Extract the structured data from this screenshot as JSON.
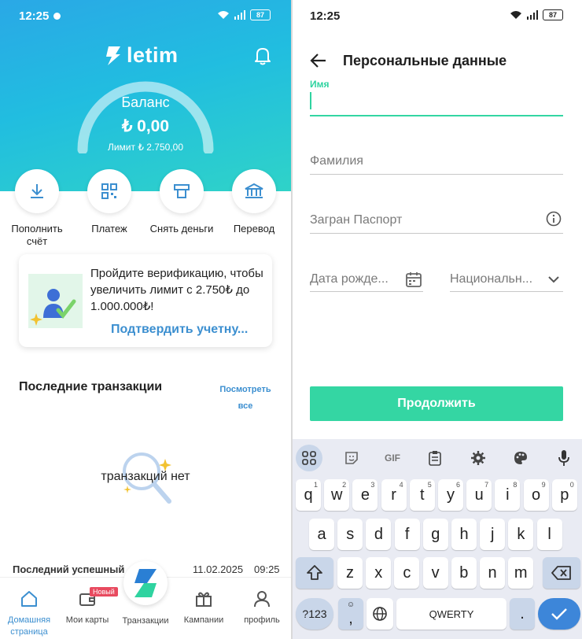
{
  "left": {
    "status": {
      "time": "12:25",
      "battery": "87"
    },
    "logo": "letim",
    "balance": {
      "title": "Баланс",
      "amount": "₺ 0,00",
      "limit": "Лимит  ₺ 2.750,00"
    },
    "actions": [
      {
        "label": "Пополнить счёт",
        "icon": "download-icon"
      },
      {
        "label": "Платеж",
        "icon": "qr-code-icon"
      },
      {
        "label": "Снять деньги",
        "icon": "atm-icon"
      },
      {
        "label": "Перевод",
        "icon": "bank-icon"
      }
    ],
    "verify_card": {
      "message": "Пройдите верификацию, чтобы увеличить лимит с 2.750₺ до 1.000.000₺!",
      "link": "Подтвердить учетну..."
    },
    "transactions": {
      "title": "Последние транзакции",
      "see_all": "Посмотреть все",
      "empty": "транзакций нет"
    },
    "last_success": {
      "label": "Последний успешный",
      "date": "11.02.2025",
      "time": "09:25"
    },
    "nav": {
      "home": "Домашняя страница",
      "cards": "Мои карты",
      "cards_badge": "Новый",
      "transactions": "Транзакции",
      "campaigns": "Кампании",
      "profile": "профиль"
    },
    "colors": {
      "accent": "#3c8fd0",
      "gradient_start": "#2aa8e6",
      "gradient_end": "#2fd3c8"
    }
  },
  "right": {
    "status": {
      "time": "12:25",
      "battery": "87"
    },
    "title": "Персональные данные",
    "fields": {
      "first_name_label": "Имя",
      "last_name_placeholder": "Фамилия",
      "passport_placeholder": "Загран Паспорт",
      "birth_placeholder": "Дата рожде...",
      "nationality_placeholder": "Национальн..."
    },
    "continue": "Продолжить",
    "keyboard": {
      "toolbar": [
        "apps-icon",
        "sticker-icon",
        "GIF",
        "clipboard-icon",
        "settings-icon",
        "palette-icon",
        "mic-icon"
      ],
      "gif": "GIF",
      "row1": [
        [
          "q",
          "1"
        ],
        [
          "w",
          "2"
        ],
        [
          "e",
          "3"
        ],
        [
          "r",
          "4"
        ],
        [
          "t",
          "5"
        ],
        [
          "y",
          "6"
        ],
        [
          "u",
          "7"
        ],
        [
          "i",
          "8"
        ],
        [
          "o",
          "9"
        ],
        [
          "p",
          "0"
        ]
      ],
      "row2": [
        "a",
        "s",
        "d",
        "f",
        "g",
        "h",
        "j",
        "k",
        "l"
      ],
      "row3": [
        "z",
        "x",
        "c",
        "v",
        "b",
        "n",
        "m"
      ],
      "sym": "?123",
      "comma": ",",
      "space": "QWERTY",
      "period": "."
    },
    "colors": {
      "accent": "#34d6a3"
    }
  }
}
